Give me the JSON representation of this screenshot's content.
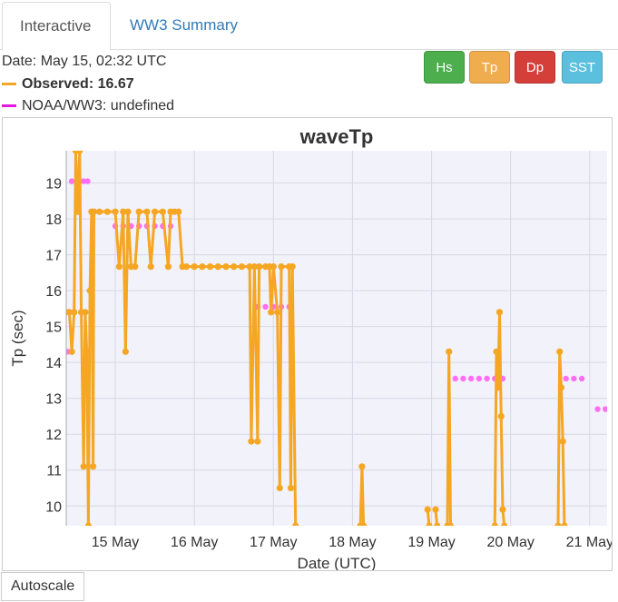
{
  "tabs": {
    "interactive": "Interactive",
    "summary": "WW3 Summary"
  },
  "info": {
    "date": "Date: May 15, 02:32 UTC",
    "observed": "Observed: 16.67",
    "model": "NOAA/WW3: undefined"
  },
  "buttons": [
    {
      "label": "Hs",
      "color": "#4cae4c"
    },
    {
      "label": "Tp",
      "color": "#f0ad4e"
    },
    {
      "label": "Dp",
      "color": "#d43f3a"
    },
    {
      "label": "SST",
      "color": "#5bc0de"
    }
  ],
  "autoscale_label": "Autoscale",
  "chart_data": {
    "type": "line",
    "title": "waveTp",
    "xlabel": "Date (UTC)",
    "ylabel": "Tp (sec)",
    "xlim": [
      14.38,
      21.22
    ],
    "ylim": [
      9.45,
      19.9
    ],
    "x_ticks": [
      15,
      16,
      17,
      18,
      19,
      20,
      21
    ],
    "x_tick_labels": [
      "15 May",
      "16 May",
      "17 May",
      "18 May",
      "19 May",
      "20 May",
      "21 May"
    ],
    "y_ticks": [
      10,
      11,
      12,
      13,
      14,
      15,
      16,
      17,
      18,
      19
    ],
    "grid": true,
    "colors": {
      "observed": "#f5a623",
      "model": "#ff6ef5",
      "plot_bg": "#f2f2fb",
      "grid": "#d8d8e6"
    },
    "series": [
      {
        "name": "Observed",
        "style": "line+markers",
        "points": [
          [
            14.38,
            15.4
          ],
          [
            14.42,
            15.4
          ],
          [
            14.45,
            14.3
          ],
          [
            14.48,
            15.4
          ],
          [
            14.5,
            20.0
          ],
          [
            14.53,
            18.2
          ],
          [
            14.55,
            20.0
          ],
          [
            14.57,
            15.4
          ],
          [
            14.6,
            11.1
          ],
          [
            14.62,
            15.4
          ],
          [
            14.64,
            14.3
          ],
          [
            14.66,
            9.45
          ],
          [
            14.68,
            16.0
          ],
          [
            14.7,
            18.2
          ],
          [
            14.72,
            11.1
          ],
          [
            14.73,
            18.2
          ],
          [
            14.8,
            18.2
          ],
          [
            14.9,
            18.2
          ],
          [
            15.0,
            18.2
          ],
          [
            15.05,
            16.67
          ],
          [
            15.1,
            18.2
          ],
          [
            15.13,
            14.3
          ],
          [
            15.16,
            18.2
          ],
          [
            15.2,
            16.67
          ],
          [
            15.25,
            16.67
          ],
          [
            15.3,
            18.2
          ],
          [
            15.4,
            18.2
          ],
          [
            15.45,
            16.67
          ],
          [
            15.5,
            18.2
          ],
          [
            15.6,
            18.2
          ],
          [
            15.67,
            16.67
          ],
          [
            15.7,
            18.2
          ],
          [
            15.75,
            18.2
          ],
          [
            15.8,
            18.2
          ],
          [
            15.85,
            16.67
          ],
          [
            15.9,
            16.67
          ],
          [
            16.0,
            16.67
          ],
          [
            16.1,
            16.67
          ],
          [
            16.2,
            16.67
          ],
          [
            16.3,
            16.67
          ],
          [
            16.4,
            16.67
          ],
          [
            16.5,
            16.67
          ],
          [
            16.6,
            16.67
          ],
          [
            16.7,
            16.67
          ],
          [
            16.72,
            11.8
          ],
          [
            16.76,
            16.67
          ],
          [
            16.8,
            11.8
          ],
          [
            16.82,
            16.67
          ],
          [
            16.9,
            16.67
          ],
          [
            16.95,
            16.67
          ],
          [
            16.97,
            15.4
          ],
          [
            17.0,
            16.67
          ],
          [
            17.05,
            15.4
          ],
          [
            17.08,
            10.5
          ],
          [
            17.1,
            16.67
          ],
          [
            17.2,
            16.67
          ],
          [
            17.22,
            10.5
          ],
          [
            17.24,
            16.67
          ],
          [
            17.28,
            9.45
          ]
        ],
        "segments": [
          [
            [
              18.1,
              9.45
            ],
            [
              18.12,
              11.1
            ],
            [
              18.14,
              9.45
            ]
          ],
          [
            [
              18.95,
              9.9
            ],
            [
              18.97,
              9.45
            ]
          ],
          [
            [
              19.05,
              9.9
            ],
            [
              19.07,
              9.45
            ]
          ],
          [
            [
              19.2,
              9.45
            ],
            [
              19.22,
              14.3
            ],
            [
              19.24,
              9.45
            ]
          ],
          [
            [
              19.8,
              9.45
            ],
            [
              19.82,
              14.3
            ],
            [
              19.84,
              13.3
            ],
            [
              19.86,
              15.4
            ],
            [
              19.88,
              12.5
            ],
            [
              19.9,
              9.9
            ],
            [
              19.92,
              9.45
            ]
          ],
          [
            [
              20.6,
              9.45
            ],
            [
              20.62,
              14.3
            ],
            [
              20.64,
              13.3
            ],
            [
              20.66,
              11.8
            ],
            [
              20.68,
              9.45
            ]
          ]
        ]
      },
      {
        "name": "NOAA/WW3",
        "style": "markers",
        "points": [
          [
            14.4,
            14.3
          ],
          [
            14.45,
            19.05
          ],
          [
            14.55,
            19.05
          ],
          [
            14.6,
            19.05
          ],
          [
            14.65,
            19.05
          ],
          [
            15.0,
            17.8
          ],
          [
            15.1,
            17.8
          ],
          [
            15.2,
            17.8
          ],
          [
            15.3,
            17.8
          ],
          [
            15.4,
            17.8
          ],
          [
            15.5,
            17.8
          ],
          [
            15.6,
            17.8
          ],
          [
            15.7,
            17.8
          ],
          [
            15.9,
            16.67
          ],
          [
            16.0,
            16.67
          ],
          [
            16.1,
            16.67
          ],
          [
            16.2,
            16.67
          ],
          [
            16.3,
            16.67
          ],
          [
            16.4,
            16.67
          ],
          [
            16.5,
            16.67
          ],
          [
            16.6,
            16.67
          ],
          [
            16.8,
            15.55
          ],
          [
            16.9,
            15.55
          ],
          [
            17.0,
            15.55
          ],
          [
            17.1,
            15.55
          ],
          [
            17.2,
            15.55
          ],
          [
            19.3,
            13.55
          ],
          [
            19.4,
            13.55
          ],
          [
            19.5,
            13.55
          ],
          [
            19.6,
            13.55
          ],
          [
            19.7,
            13.55
          ],
          [
            19.8,
            13.55
          ],
          [
            19.9,
            13.55
          ],
          [
            20.7,
            13.55
          ],
          [
            20.8,
            13.55
          ],
          [
            20.9,
            13.55
          ],
          [
            21.1,
            12.7
          ],
          [
            21.2,
            12.7
          ]
        ]
      }
    ]
  }
}
